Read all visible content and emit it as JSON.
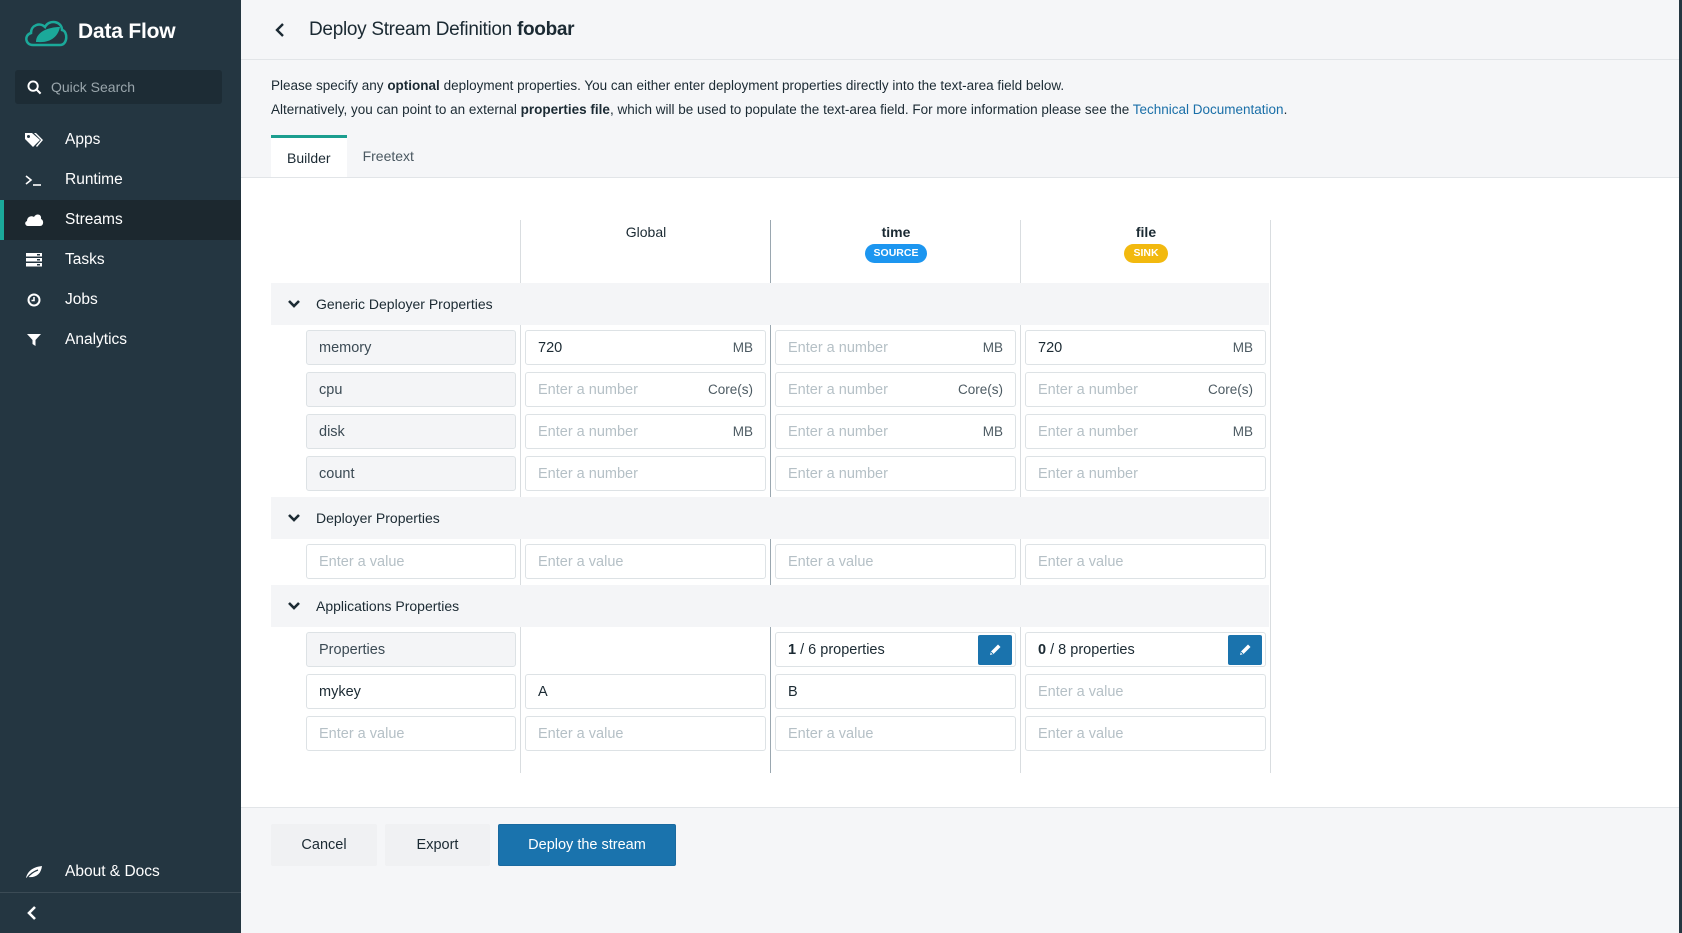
{
  "sidebar": {
    "brand": "Data Flow",
    "search_placeholder": "Quick Search",
    "items": [
      {
        "label": "Apps",
        "icon": "tags-icon"
      },
      {
        "label": "Runtime",
        "icon": "terminal-icon"
      },
      {
        "label": "Streams",
        "icon": "cloud-icon",
        "active": true
      },
      {
        "label": "Tasks",
        "icon": "tasks-icon"
      },
      {
        "label": "Jobs",
        "icon": "clock-icon"
      },
      {
        "label": "Analytics",
        "icon": "filter-icon"
      }
    ],
    "about": "About & Docs",
    "accent": "#1ba99a"
  },
  "header": {
    "title_prefix": "Deploy Stream Definition",
    "stream_name": "foobar"
  },
  "intro": {
    "line1_a": "Please specify any ",
    "line1_bold": "optional",
    "line1_b": " deployment properties. You can either enter deployment properties directly into the text-area field below.",
    "line2_a": "Alternatively, you can point to an external ",
    "line2_bold": "properties file",
    "line2_b": ", which will be used to populate the text-area field. For more information please see the ",
    "link": "Technical Documentation",
    "line2_end": "."
  },
  "tabs": [
    {
      "label": "Builder",
      "active": true
    },
    {
      "label": "Freetext",
      "active": false
    }
  ],
  "columns": [
    {
      "name": "Global"
    },
    {
      "name": "time",
      "badge": "SOURCE",
      "badge_color": "#1c96f0"
    },
    {
      "name": "file",
      "badge": "SINK",
      "badge_color": "#f2b90f"
    }
  ],
  "sections": {
    "generic": "Generic Deployer Properties",
    "deployer": "Deployer Properties",
    "applications": "Applications Properties"
  },
  "generic_rows": [
    {
      "key": "memory",
      "unit": "MB",
      "values": [
        "720",
        "",
        "720"
      ]
    },
    {
      "key": "cpu",
      "unit": "Core(s)",
      "values": [
        "",
        "",
        ""
      ]
    },
    {
      "key": "disk",
      "unit": "MB",
      "values": [
        "",
        "",
        ""
      ]
    },
    {
      "key": "count",
      "unit": "",
      "values": [
        "",
        "",
        ""
      ]
    }
  ],
  "placeholders": {
    "number": "Enter a number",
    "value": "Enter a value"
  },
  "applications": {
    "properties_label": "Properties",
    "time_selected": "1",
    "time_total": " / 6 properties",
    "file_selected": "0",
    "file_total": " / 8 properties",
    "custom_key": "mykey",
    "custom_values": [
      "A",
      "B",
      ""
    ]
  },
  "footer": {
    "cancel": "Cancel",
    "export": "Export",
    "deploy": "Deploy the stream"
  }
}
